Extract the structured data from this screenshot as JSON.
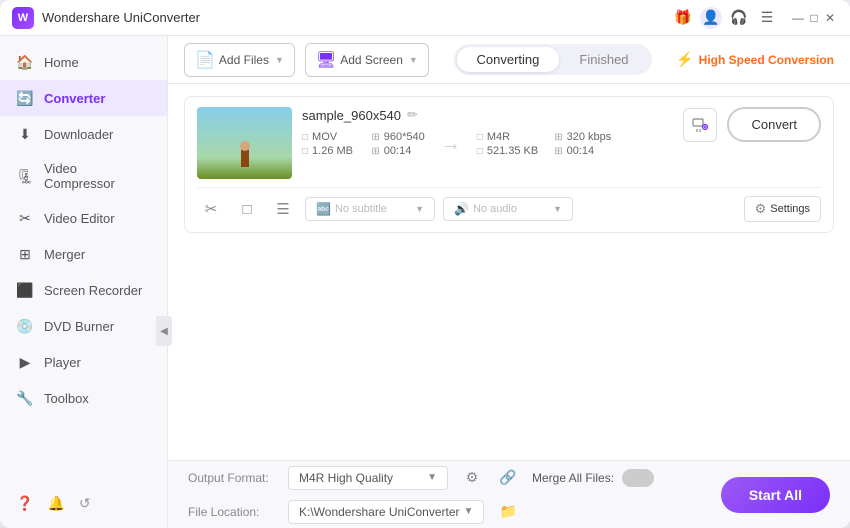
{
  "titleBar": {
    "appName": "Wondershare UniConverter",
    "controls": {
      "minimize": "—",
      "maximize": "□",
      "close": "✕"
    }
  },
  "sidebar": {
    "items": [
      {
        "id": "home",
        "label": "Home",
        "icon": "🏠",
        "active": false
      },
      {
        "id": "converter",
        "label": "Converter",
        "icon": "🔄",
        "active": true
      },
      {
        "id": "downloader",
        "label": "Downloader",
        "icon": "⬇",
        "active": false
      },
      {
        "id": "video-compressor",
        "label": "Video Compressor",
        "icon": "🗜",
        "active": false
      },
      {
        "id": "video-editor",
        "label": "Video Editor",
        "icon": "✂",
        "active": false
      },
      {
        "id": "merger",
        "label": "Merger",
        "icon": "⊞",
        "active": false
      },
      {
        "id": "screen-recorder",
        "label": "Screen Recorder",
        "icon": "⬛",
        "active": false
      },
      {
        "id": "dvd-burner",
        "label": "DVD Burner",
        "icon": "💿",
        "active": false
      },
      {
        "id": "player",
        "label": "Player",
        "icon": "▶",
        "active": false
      },
      {
        "id": "toolbox",
        "label": "Toolbox",
        "icon": "🔧",
        "active": false
      }
    ],
    "bottomIcons": [
      "?",
      "🔔",
      "↺"
    ]
  },
  "toolbar": {
    "addFileLabel": "Add Files",
    "addScreenLabel": "Add Screen"
  },
  "tabs": {
    "converting": {
      "label": "Converting",
      "active": true
    },
    "finished": {
      "label": "Finished",
      "active": false
    }
  },
  "highSpeedConversion": {
    "label": "High Speed Conversion",
    "icon": "⚡"
  },
  "fileItem": {
    "name": "sample_960x540",
    "thumbnail": "beach",
    "source": {
      "format": "MOV",
      "resolution": "960*540",
      "size": "1.26 MB",
      "duration": "00:14"
    },
    "target": {
      "format": "M4R",
      "bitrate": "320 kbps",
      "size": "521.35 KB",
      "duration": "00:14"
    },
    "subtitle": {
      "placeholder": "No subtitle"
    },
    "audio": {
      "placeholder": "No audio"
    },
    "settingsLabel": "Settings",
    "convertLabel": "Convert"
  },
  "bottomBar": {
    "outputFormatLabel": "Output Format:",
    "outputFormatValue": "M4R High Quality",
    "fileLocationLabel": "File Location:",
    "fileLocationValue": "K:\\Wondershare UniConverter",
    "mergeAllFilesLabel": "Merge All Files:",
    "startAllLabel": "Start All"
  }
}
